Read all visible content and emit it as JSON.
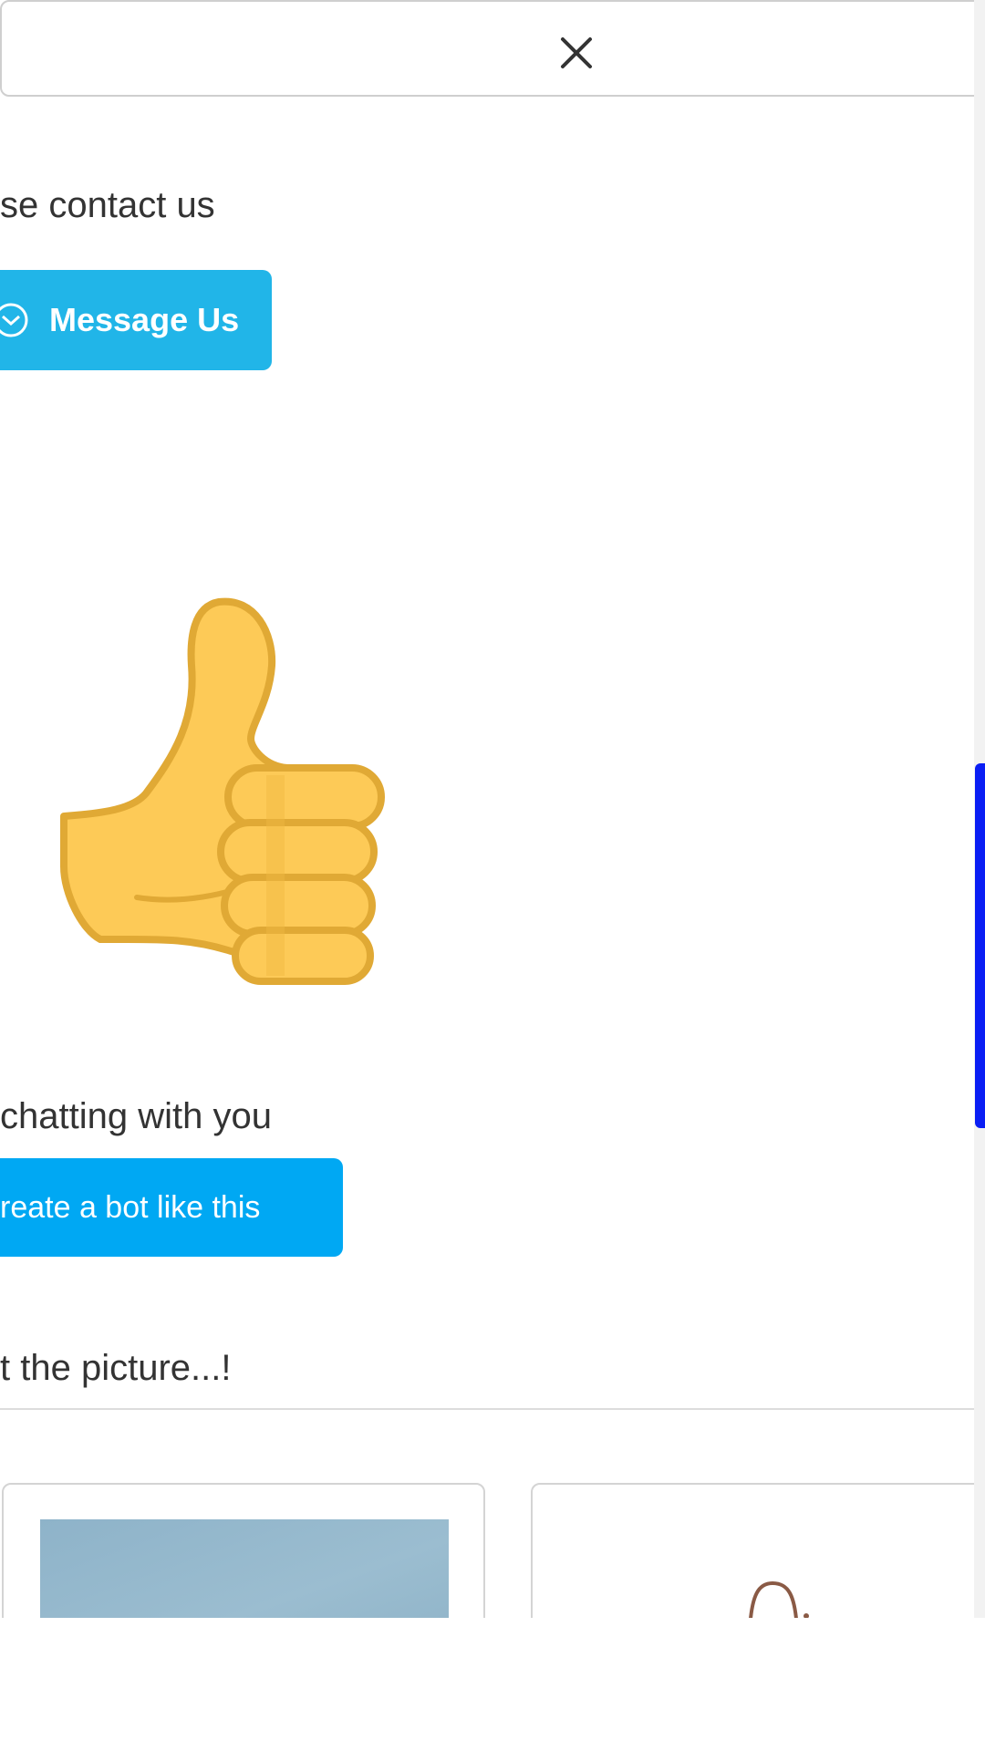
{
  "header": {
    "close_icon": "close-icon"
  },
  "contact": {
    "text": "se contact us",
    "button_label": "Message Us",
    "button_icon": "messenger-icon"
  },
  "emoji": {
    "icon": "thumbs-up-icon"
  },
  "chat": {
    "text": "chatting with you",
    "button_label": "reate a bot like this"
  },
  "picture": {
    "text": "t the picture...!"
  },
  "colors": {
    "message_button": "#21b5e8",
    "bot_button": "#00a8f3",
    "scrollbar_thumb": "#0a1ef4",
    "thumb_fill": "#FDCA57",
    "thumb_outline": "#E0A935"
  }
}
